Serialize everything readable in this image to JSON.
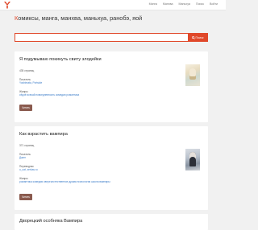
{
  "header": {
    "nav": [
      "Манга",
      "Манхва",
      "Маньхуа",
      "Поиск",
      "Войти"
    ]
  },
  "page": {
    "title_first": "К",
    "title_rest": "омиксы, манга, манхва, маньхуа, ранобэ, яой"
  },
  "search": {
    "placeholder": "",
    "button_label": "Поиск"
  },
  "colors": {
    "accent": "#e0482a",
    "read_button": "#8a5a4e",
    "link": "#3a7bc8"
  },
  "cards": [
    {
      "title": "Я подумываю покинуть свиту злодейки",
      "pages": "435 страниц",
      "author_label": "Писатель",
      "author": "Yoshimata, Portside",
      "genres_label": "Жанры",
      "genres": "сёдзё исекай повседневность комедия романтика",
      "read_label": "Читать"
    },
    {
      "title": "Как взрастить вампира",
      "pages": "371 страниц",
      "author_label": "Писатель",
      "author": "Джин",
      "translator_label": "Переводчик",
      "translator": "o_cat, zerkas.ru",
      "genres_label": "Жанры",
      "genres": "романтика комедия сверхъестественное драма психология школа вампиры",
      "read_label": "Читать"
    }
  ],
  "card3": {
    "title": "Дворецкий особняка Вампира"
  }
}
